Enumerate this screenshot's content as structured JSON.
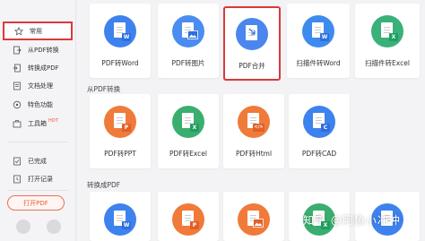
{
  "sidebar": {
    "items": [
      {
        "label": "常用",
        "icon": "star-icon"
      },
      {
        "label": "从PDF转换",
        "icon": "file-export-icon"
      },
      {
        "label": "转换成PDF",
        "icon": "file-import-icon"
      },
      {
        "label": "文档处理",
        "icon": "document-icon"
      },
      {
        "label": "特色功能",
        "icon": "feature-icon"
      },
      {
        "label": "工具箱",
        "icon": "toolbox-icon",
        "badge": "HOT"
      },
      {
        "label": "已完成",
        "icon": "completed-icon"
      },
      {
        "label": "打开记录",
        "icon": "history-icon"
      }
    ],
    "open_button": "打开PDF"
  },
  "sections": [
    {
      "title": "",
      "cards": [
        {
          "label": "PDF转Word",
          "color": "#3e82ee",
          "badge": "W",
          "badge_color": "#2f6fdb",
          "icon": "pdf-to-word-icon"
        },
        {
          "label": "PDF转图片",
          "color": "#4a8cf0",
          "badge": "",
          "badge_color": "#2f6fdb",
          "icon": "pdf-to-image-icon"
        },
        {
          "label": "PDF合并",
          "color": "#4a86ee",
          "badge": "",
          "badge_color": "#2f6fdb",
          "icon": "pdf-merge-icon"
        },
        {
          "label": "扫描件转Word",
          "color": "#3e8bef",
          "badge": "W",
          "badge_color": "#2f6fdb",
          "icon": "scan-to-word-icon"
        },
        {
          "label": "扫描件转Excel",
          "color": "#3ab07a",
          "badge": "X",
          "badge_color": "#1f9e60",
          "icon": "scan-to-excel-icon"
        }
      ]
    },
    {
      "title": "从PDF转换",
      "cards": [
        {
          "label": "PDF转PPT",
          "color": "#f07a3a",
          "badge": "P",
          "badge_color": "#e0602a",
          "icon": "pdf-to-ppt-icon"
        },
        {
          "label": "PDF转Excel",
          "color": "#3aae6e",
          "badge": "X",
          "badge_color": "#1f9e60",
          "icon": "pdf-to-excel-icon"
        },
        {
          "label": "PDF转Html",
          "color": "#f07a3a",
          "badge": "</>",
          "badge_color": "#e0602a",
          "icon": "pdf-to-html-icon"
        },
        {
          "label": "PDF转CAD",
          "color": "#3e82ee",
          "badge": "C",
          "badge_color": "#2f6fdb",
          "icon": "pdf-to-cad-icon"
        }
      ]
    },
    {
      "title": "转换成PDF",
      "cards": [
        {
          "label": "",
          "color": "#3e82ee",
          "badge": "W",
          "badge_color": "#2f6fdb",
          "icon": "word-to-pdf-icon"
        },
        {
          "label": "",
          "color": "#f07a3a",
          "badge": "P",
          "badge_color": "#e0602a",
          "icon": "ppt-to-pdf-icon"
        },
        {
          "label": "",
          "color": "#f07a3a",
          "badge": "",
          "badge_color": "#e0602a",
          "icon": "image-to-pdf-icon"
        },
        {
          "label": "",
          "color": "#3aae6e",
          "badge": "X",
          "badge_color": "#1f9e60",
          "icon": "excel-to-pdf-icon"
        },
        {
          "label": "",
          "color": "#3e82ee",
          "badge": "",
          "badge_color": "#2f6fdb",
          "icon": "file-to-pdf-icon"
        }
      ]
    }
  ],
  "watermark": "知乎 @阿鱼小冲冲",
  "colors": {
    "highlight": "#d93a3a",
    "accent": "#e8603a"
  }
}
